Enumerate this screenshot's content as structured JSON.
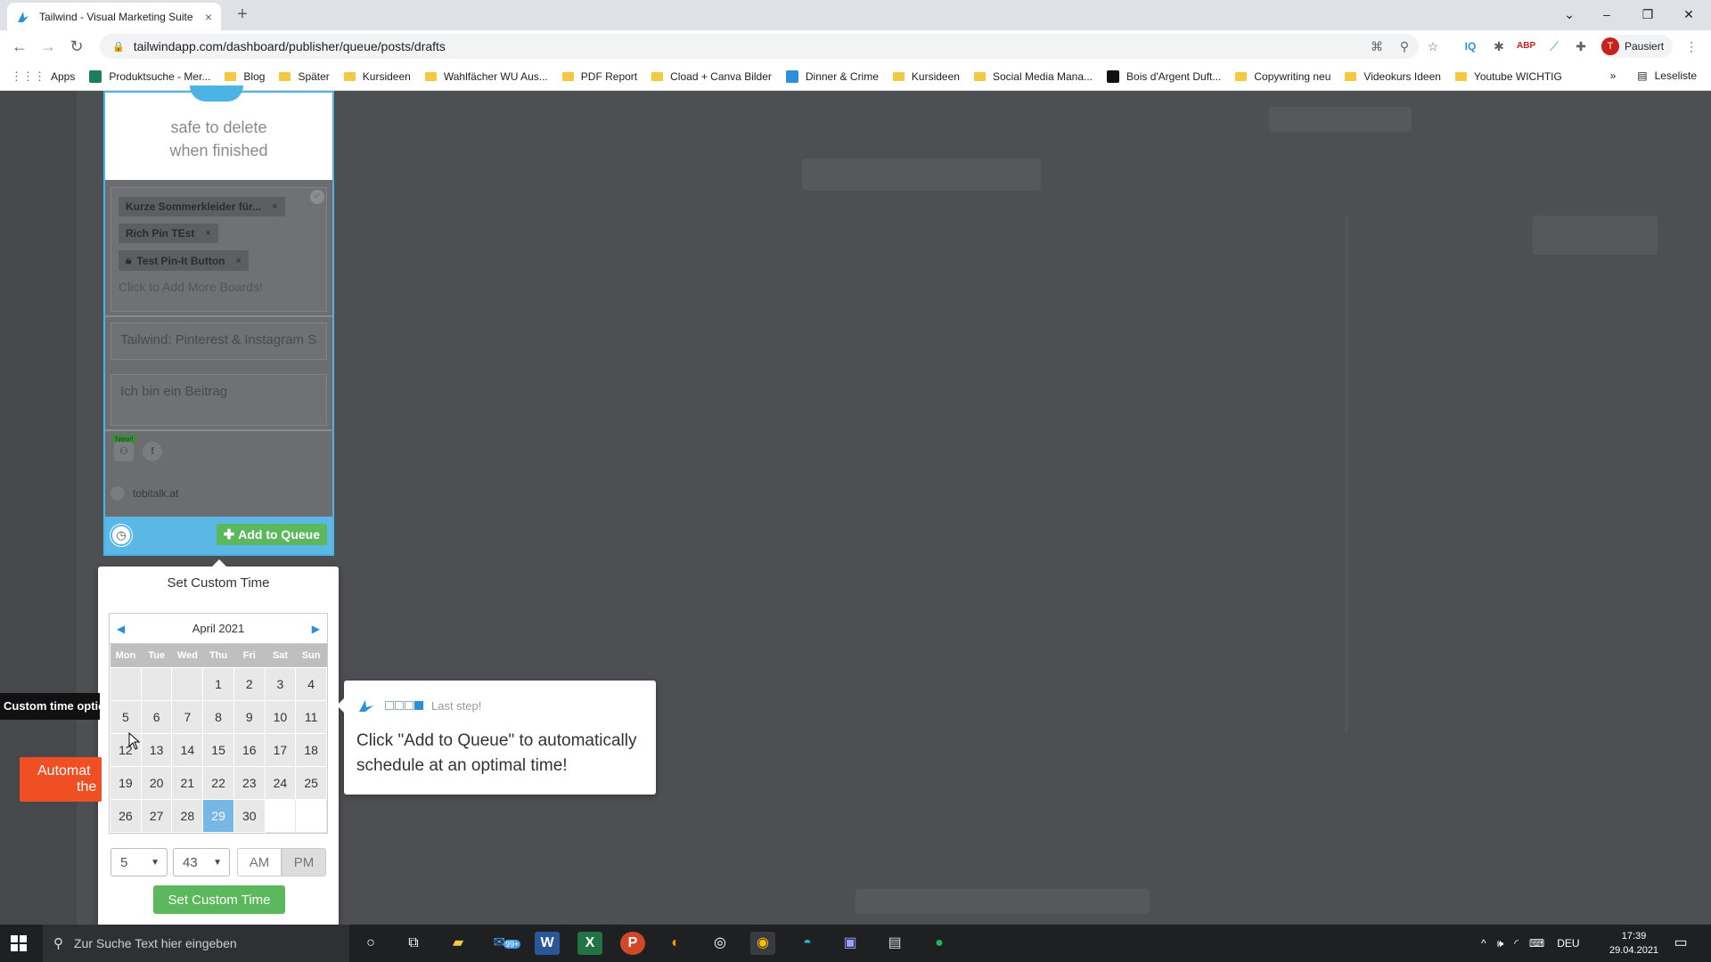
{
  "browser": {
    "tab_title": "Tailwind - Visual Marketing Suite",
    "tab_close": "×",
    "new_tab": "+",
    "url": "tailwindapp.com/dashboard/publisher/queue/posts/drafts",
    "profile_initial": "T",
    "profile_label": "Pausiert",
    "window_controls": [
      "–",
      "❐",
      "✕"
    ]
  },
  "bookmarks": {
    "items": [
      "Apps",
      "Produktsuche - Mer...",
      "Blog",
      "Später",
      "Kursideen",
      "Wahlfächer WU Aus...",
      "PDF Report",
      "Cload + Canva Bilder",
      "Dinner & Crime",
      "Kursideen",
      "Social Media Mana...",
      "Bois d'Argent Duft...",
      "Copywriting neu",
      "Videokurs Ideen",
      "Youtube WICHTIG"
    ],
    "more": "»",
    "reading_list": "Leseliste"
  },
  "card": {
    "header_line1": "safe to delete",
    "header_line2": "when finished",
    "boards": [
      "Kurze Sommerkleider für...",
      "Rich Pin TEst",
      "Test Pin-It Button"
    ],
    "chip_remove": "×",
    "add_boards_placeholder": "Click to Add More Boards!",
    "title_field": "Tailwind: Pinterest & Instagram S",
    "description_field": "Ich bin ein Beitrag",
    "new_badge": "New!",
    "site": "tobitalk.at",
    "add_to_queue": "Add to Queue"
  },
  "custom_time": {
    "title": "Set Custom Time",
    "month": "April 2021",
    "prev": "◀",
    "next": "▶",
    "weekdays": [
      "Mon",
      "Tue",
      "Wed",
      "Thu",
      "Fri",
      "Sat",
      "Sun"
    ],
    "weeks": [
      [
        "",
        "",
        "",
        "1",
        "2",
        "3",
        "4"
      ],
      [
        "5",
        "6",
        "7",
        "8",
        "9",
        "10",
        "11"
      ],
      [
        "12",
        "13",
        "14",
        "15",
        "16",
        "17",
        "18"
      ],
      [
        "19",
        "20",
        "21",
        "22",
        "23",
        "24",
        "25"
      ],
      [
        "26",
        "27",
        "28",
        "29",
        "30",
        "",
        ""
      ]
    ],
    "selected_day": "29",
    "hour": "5",
    "minute": "43",
    "am": "AM",
    "pm": "PM",
    "selected_period": "PM",
    "submit": "Set Custom Time"
  },
  "tour": {
    "label": "Last step!",
    "steps_total": 4,
    "current_step": 4,
    "text": "Click \"Add to Queue\" to automatically schedule at an optimal time!"
  },
  "left_labels": {
    "tooltip": "Custom time optio",
    "red_line1": "Automat",
    "red_line2": "the"
  },
  "taskbar": {
    "search_placeholder": "Zur Suche Text hier eingeben",
    "mail_badge": "99+",
    "lang": "DEU",
    "time": "17:39",
    "date": "29.04.2021"
  },
  "colors": {
    "accent_blue": "#4bb3e5",
    "green": "#5cb85c",
    "selected_day": "#77b7e6",
    "orange": "#f04e23"
  }
}
